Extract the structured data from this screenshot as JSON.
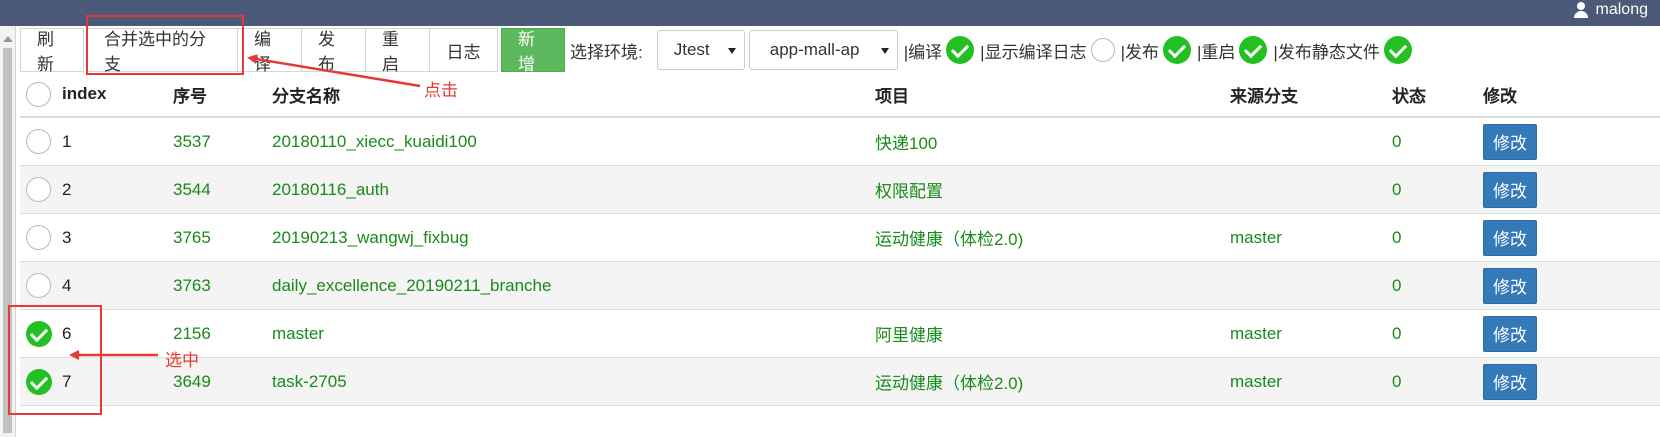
{
  "header": {
    "username": "malong"
  },
  "toolbar": {
    "buttons": [
      "刷新",
      "合并选中的分支",
      "编译",
      "发布",
      "重启",
      "日志"
    ],
    "add_label": "新增",
    "env_label": "选择环境:",
    "env_select_value": "Jtest",
    "app_select_value": "app-mall-ap",
    "options": [
      {
        "label": "|编译",
        "checked": true
      },
      {
        "label": "|显示编译日志",
        "checked": false
      },
      {
        "label": "|发布",
        "checked": true
      },
      {
        "label": "|重启",
        "checked": true
      },
      {
        "label": "|发布静态文件",
        "checked": true
      }
    ]
  },
  "table": {
    "columns": [
      "index",
      "序号",
      "分支名称",
      "项目",
      "来源分支",
      "状态",
      "修改"
    ],
    "edit_label": "修改",
    "rows": [
      {
        "index": "1",
        "seq": "3537",
        "name": "20180110_xiecc_kuaidi100",
        "project": "快递100",
        "source": "",
        "status": "0",
        "selected": false
      },
      {
        "index": "2",
        "seq": "3544",
        "name": "20180116_auth",
        "project": "权限配置",
        "source": "",
        "status": "0",
        "selected": false
      },
      {
        "index": "3",
        "seq": "3765",
        "name": "20190213_wangwj_fixbug",
        "project": "运动健康（体检2.0)",
        "source": "master",
        "status": "0",
        "selected": false
      },
      {
        "index": "4",
        "seq": "3763",
        "name": "daily_excellence_20190211_branche",
        "project": "",
        "source": "",
        "status": "0",
        "selected": false
      },
      {
        "index": "6",
        "seq": "2156",
        "name": "master",
        "project": "阿里健康",
        "source": "master",
        "status": "0",
        "selected": true
      },
      {
        "index": "7",
        "seq": "3649",
        "name": "task-2705",
        "project": "运动健康（体检2.0)",
        "source": "master",
        "status": "0",
        "selected": true
      }
    ]
  },
  "annotations": {
    "click_label": "点击",
    "selected_label": "选中"
  },
  "colors": {
    "topbar": "#4b5a79",
    "add_button": "#5cb85c",
    "edit_button": "#337ab7",
    "check": "#22c022",
    "annotation": "#e53935",
    "cell_text": "#1a8a1a"
  }
}
